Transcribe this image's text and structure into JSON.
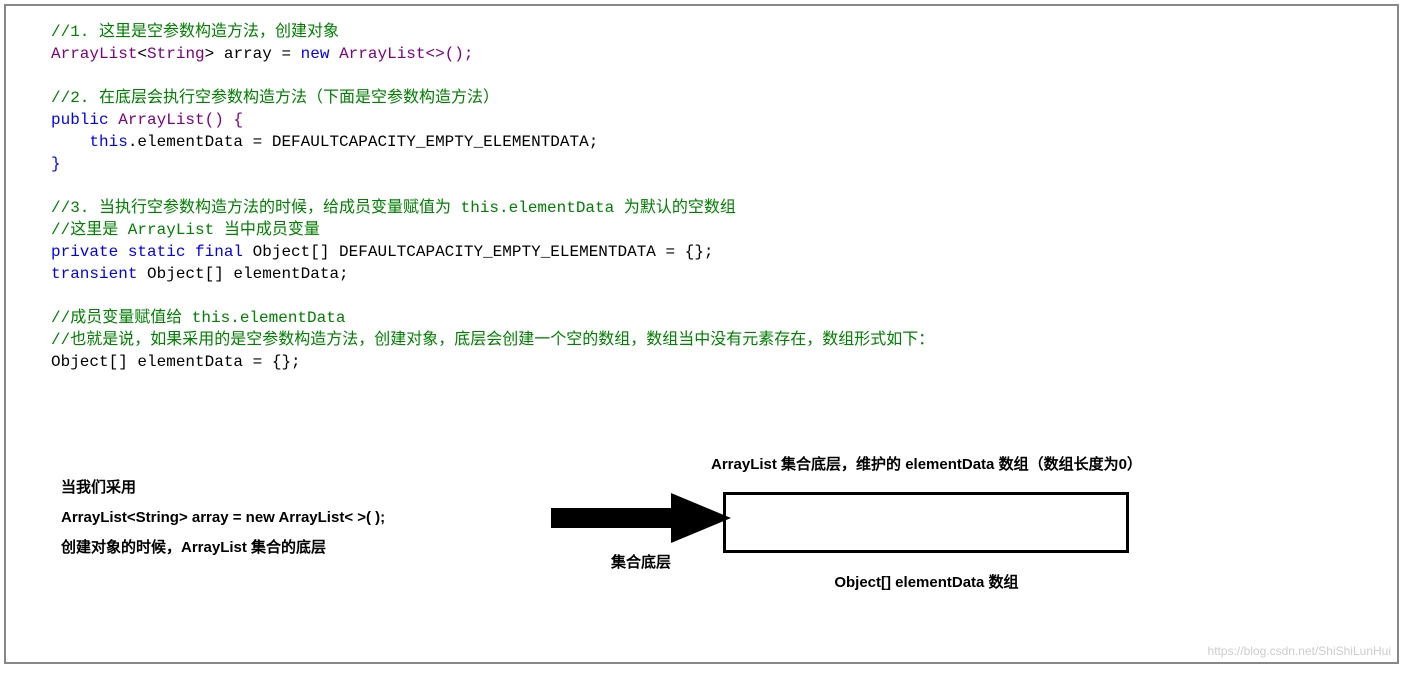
{
  "code": {
    "c1": "//1. 这里是空参数构造方法，创建对象",
    "l1_type1": "ArrayList",
    "l1_generic": "String",
    "l1_var": " array ",
    "l1_eq": "= ",
    "l1_new": "new ",
    "l1_type2": "ArrayList<>();",
    "c2": "//2. 在底层会执行空参数构造方法（下面是空参数构造方法）",
    "l2_public": "public ",
    "l2_name": "ArrayList() {",
    "l2_this": "this",
    "l2_rest": ".elementData = DEFAULTCAPACITY_EMPTY_ELEMENTDATA;",
    "l2_close": "}",
    "c3": "//3. 当执行空参数构造方法的时候，给成员变量赋值为 this.elementData 为默认的空数组",
    "c3b": "//这里是 ArrayList 当中成员变量",
    "l3_kw": "private static final ",
    "l3_rest": "Object[] DEFAULTCAPACITY_EMPTY_ELEMENTDATA = {};",
    "l4_kw": "transient ",
    "l4_rest": "Object[] elementData;",
    "c4": "//成员变量赋值给 this.elementData",
    "c5": "//也就是说，如果采用的是空参数构造方法，创建对象，底层会创建一个空的数组，数组当中没有元素存在，数组形式如下：",
    "l5": "Object[] elementData = {};"
  },
  "diagram": {
    "left_line1": "当我们采用",
    "left_line2": "ArrayList<String>   array = new  ArrayList< >( );",
    "left_line3": "创建对象的时候，ArrayList 集合的底层",
    "arrow_label": "集合底层",
    "right_title": "ArrayList 集合底层，维护的 elementData 数组（数组长度为0）",
    "array_label": "Object[]   elementData 数组"
  },
  "watermark": "https://blog.csdn.net/ShiShiLunHui"
}
